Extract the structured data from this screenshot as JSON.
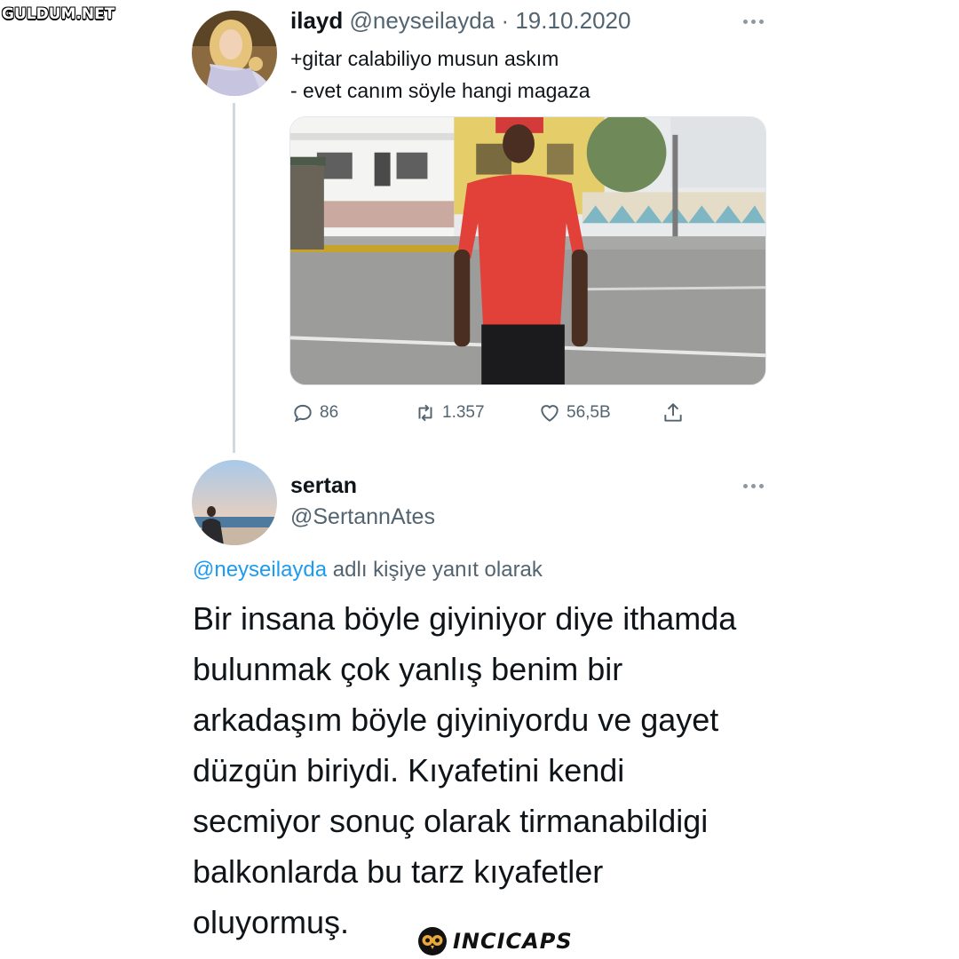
{
  "watermark": "GULDUM.NET",
  "tweet1": {
    "name": "ilayd",
    "handle": "@neyseilayda",
    "separator": "·",
    "date": "19.10.2020",
    "lines": [
      "+gitar calabiliyo musun askım",
      "- evet canım söyle hangi magaza"
    ],
    "actions": {
      "reply": "86",
      "retweet": "1.357",
      "like": "56,5B"
    }
  },
  "tweet2": {
    "name": "sertan",
    "handle": "@SertannAtes",
    "reply_to_mention": "@neyseilayda",
    "reply_to_suffix": " adlı kişiye yanıt olarak",
    "lines": [
      "Bir insana böyle giyiniyor diye ithamda",
      "bulunmak çok yanlış benim bir",
      "arkadaşım böyle giyiniyordu ve gayet",
      "düzgün biriydi. Kıyafetini kendi",
      "secmiyor sonuç olarak tirmanabildigi",
      "balkonlarda bu tarz kıyafetler",
      "oluyormuş."
    ]
  },
  "footer": {
    "brand": "INCICAPS"
  },
  "colors": {
    "accent": "#1d9bf0",
    "muted": "#536471",
    "text": "#0f1419",
    "thread": "#cfd9de"
  }
}
